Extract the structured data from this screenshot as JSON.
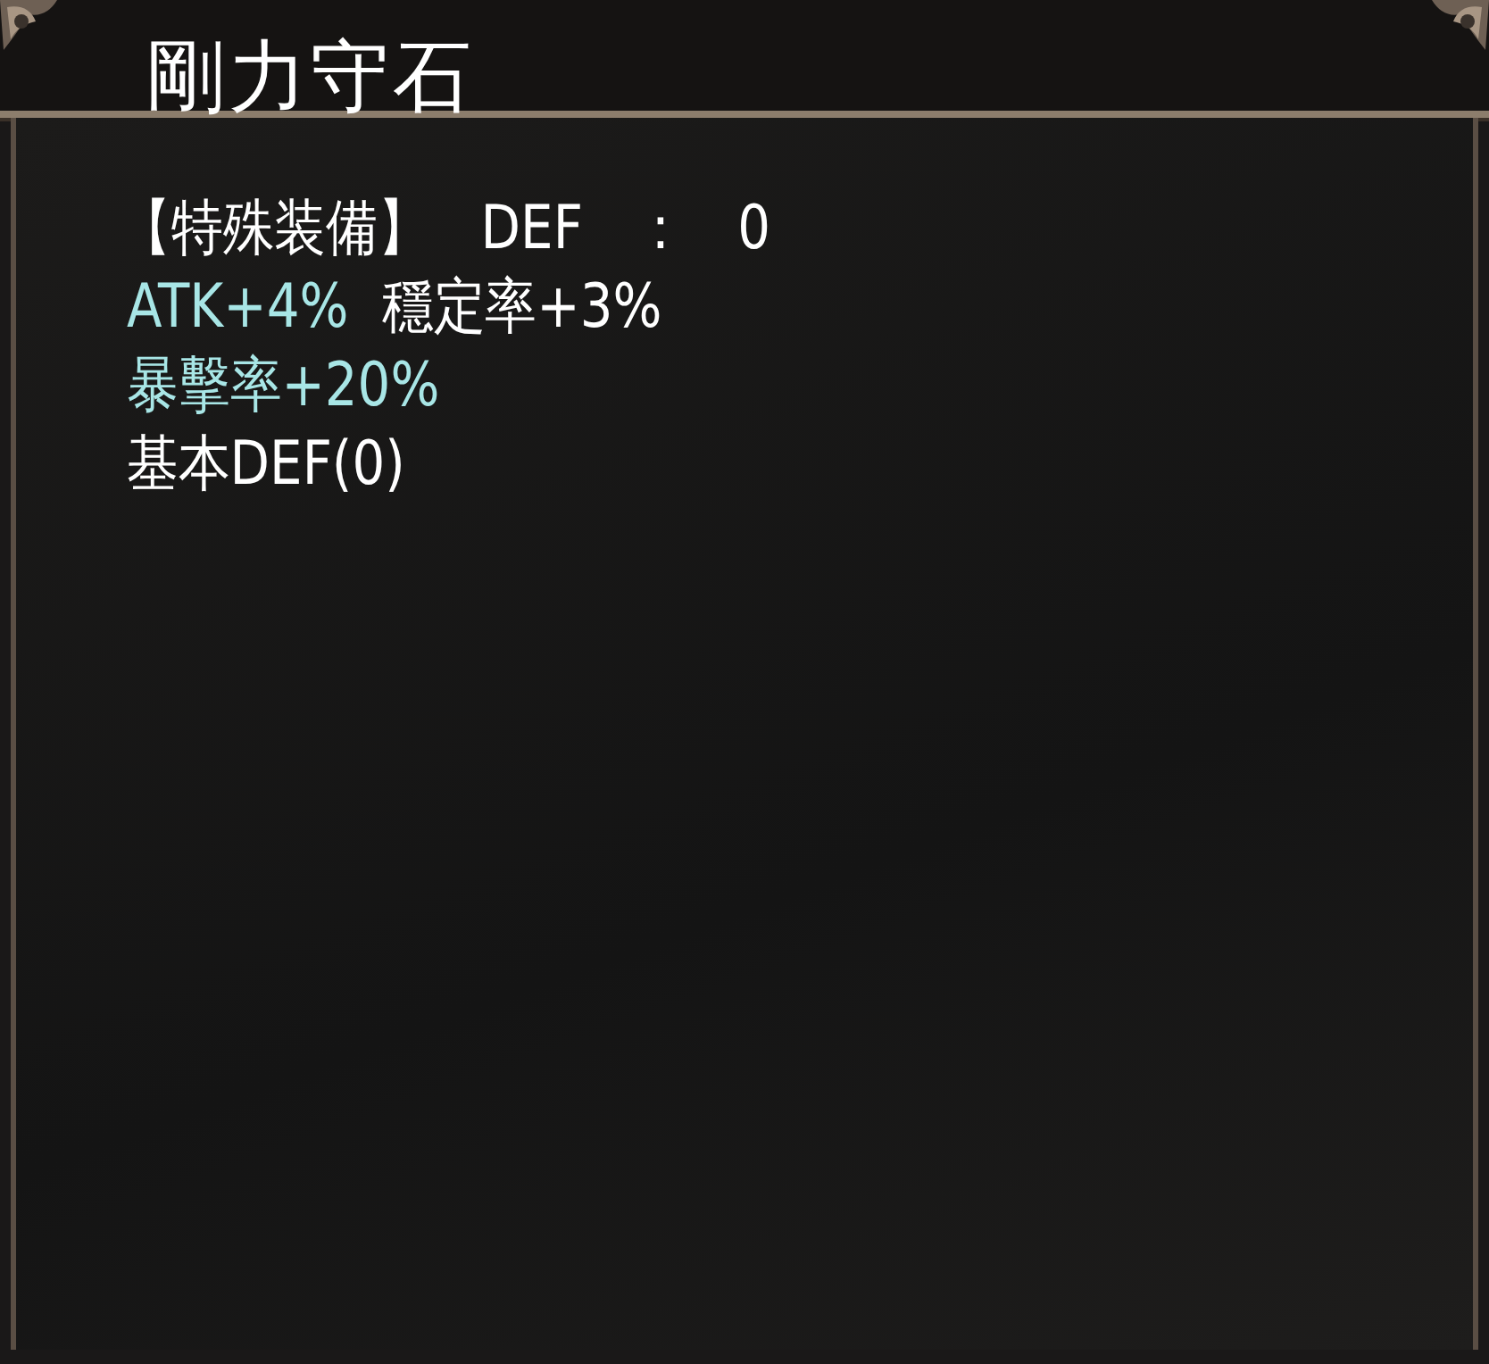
{
  "title": "剛力守石",
  "lines": [
    {
      "segments": [
        {
          "text": "【特殊装備】",
          "color": "#ffffff"
        },
        {
          "text": "DEF",
          "color": "#ffffff"
        },
        {
          "text": "：",
          "color": "#ffffff"
        },
        {
          "text": "0",
          "color": "#ffffff"
        }
      ]
    },
    {
      "segments": [
        {
          "text": "ATK+4%",
          "color": "#a8e6e6"
        },
        {
          "text": "穩定率+3%",
          "color": "#ffffff"
        }
      ]
    },
    {
      "segments": [
        {
          "text": "暴擊率+20%",
          "color": "#a8e6e6"
        }
      ]
    },
    {
      "segments": [
        {
          "text": "基本DEF(0)",
          "color": "#ffffff"
        }
      ]
    }
  ]
}
